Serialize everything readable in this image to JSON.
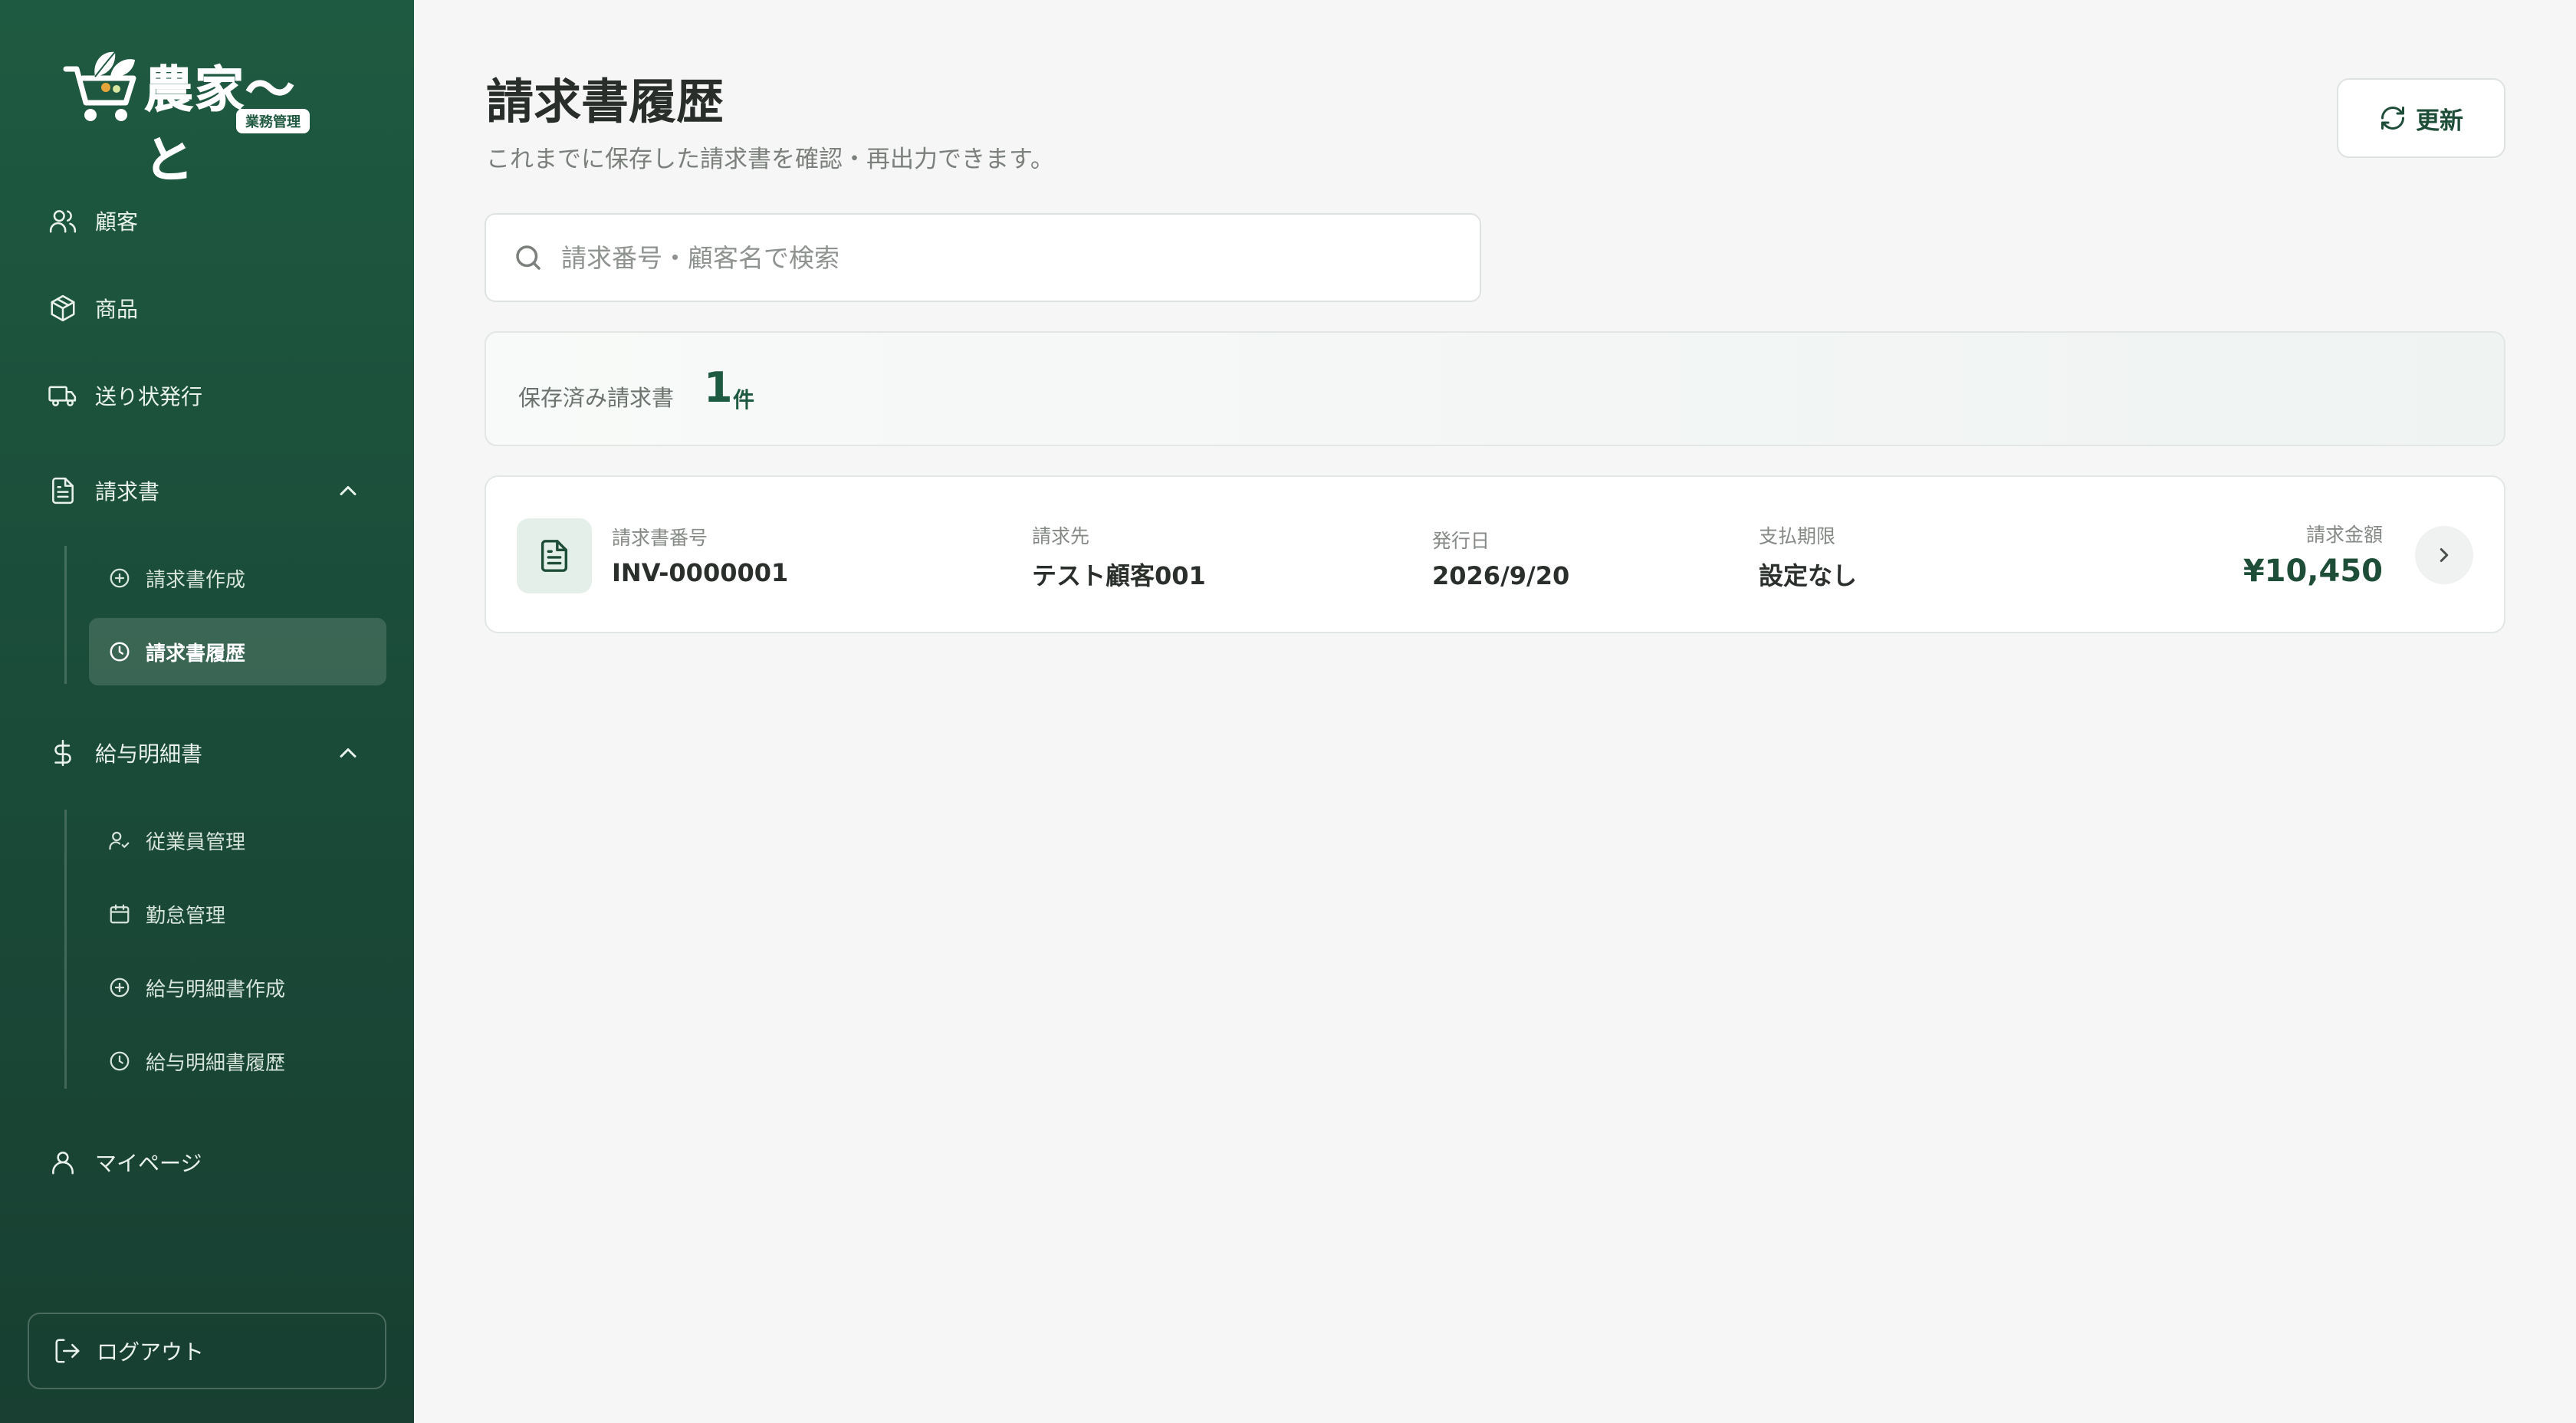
{
  "app": {
    "brand": "農家〜と",
    "brand_tag": "業務管理"
  },
  "sidebar": {
    "items": [
      {
        "label": "顧客",
        "icon": "users-icon"
      },
      {
        "label": "商品",
        "icon": "package-icon"
      },
      {
        "label": "送り状発行",
        "icon": "truck-icon"
      },
      {
        "label": "請求書",
        "icon": "file-text-icon",
        "expanded": true,
        "children": [
          {
            "label": "請求書作成",
            "icon": "plus-circle-icon"
          },
          {
            "label": "請求書履歴",
            "icon": "clock-icon",
            "active": true
          }
        ]
      },
      {
        "label": "給与明細書",
        "icon": "dollar-icon",
        "expanded": true,
        "children": [
          {
            "label": "従業員管理",
            "icon": "user-check-icon"
          },
          {
            "label": "勤怠管理",
            "icon": "calendar-icon"
          },
          {
            "label": "給与明細書作成",
            "icon": "plus-circle-icon"
          },
          {
            "label": "給与明細書履歴",
            "icon": "clock-icon"
          }
        ]
      },
      {
        "label": "マイページ",
        "icon": "user-icon"
      }
    ],
    "logout_label": "ログアウト"
  },
  "header": {
    "title": "請求書履歴",
    "subtitle": "これまでに保存した請求書を確認・再出力できます。",
    "refresh_label": "更新"
  },
  "search": {
    "placeholder": "請求番号・顧客名で検索",
    "value": ""
  },
  "summary": {
    "label": "保存済み請求書",
    "count": "1",
    "unit": "件"
  },
  "invoices": [
    {
      "number_label": "請求書番号",
      "number": "INV-0000001",
      "client_label": "請求先",
      "client": "テスト顧客001",
      "issue_label": "発行日",
      "issue_date": "2026/9/20",
      "due_label": "支払期限",
      "due": "設定なし",
      "amount_label": "請求金額",
      "amount": "¥10,450"
    }
  ],
  "colors": {
    "sidebar": "#1e5a41",
    "accent": "#1e4d38",
    "background": "#f5f6f5"
  }
}
